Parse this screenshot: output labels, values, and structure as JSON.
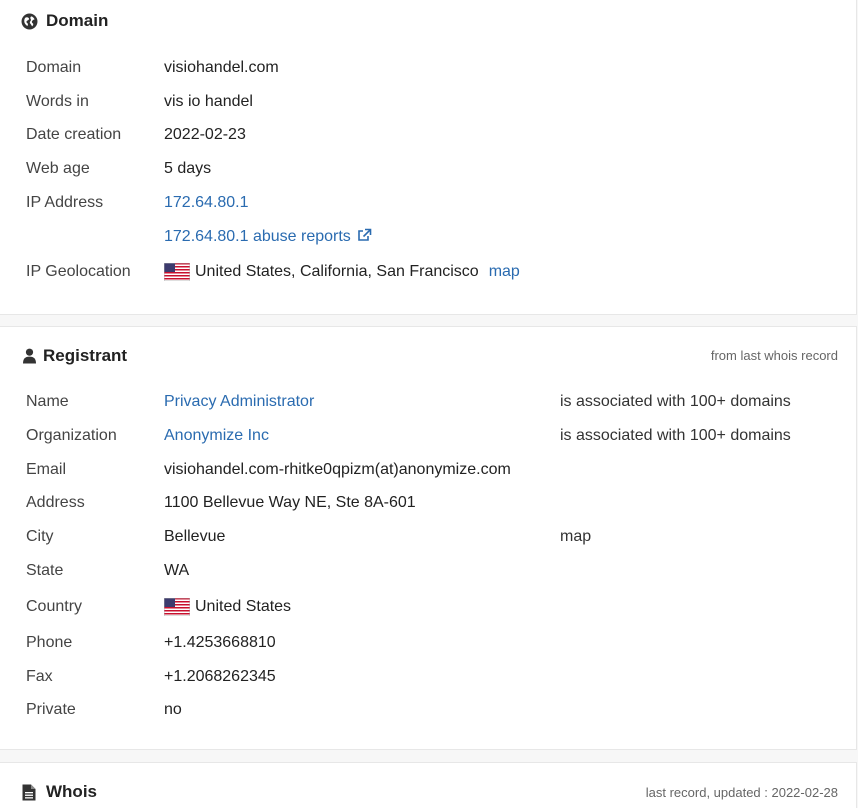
{
  "domain_panel": {
    "title": "Domain",
    "rows": [
      {
        "label": "Domain",
        "value": "visiohandel.com"
      },
      {
        "label": "Words in",
        "value": "vis io handel"
      },
      {
        "label": "Date creation",
        "value": "2022-02-23"
      },
      {
        "label": "Web age",
        "value": "5 days"
      },
      {
        "label": "IP Address",
        "value": "172.64.80.1"
      },
      {
        "label": "",
        "value": "172.64.80.1 abuse reports"
      },
      {
        "label": "IP Geolocation",
        "value": "United States, California, San Francisco",
        "map": "map"
      }
    ]
  },
  "registrant_panel": {
    "title": "Registrant",
    "note": "from last whois record",
    "rows": [
      {
        "label": "Name",
        "value": "Privacy Administrator",
        "extra": "is associated with 100+ domains"
      },
      {
        "label": "Organization",
        "value": "Anonymize Inc",
        "extra": "is associated with 100+ domains"
      },
      {
        "label": "Email",
        "value": "visiohandel.com-rhitke0qpizm(at)anonymize.com"
      },
      {
        "label": "Address",
        "value": "1100 Bellevue Way NE, Ste 8A-601"
      },
      {
        "label": "City",
        "value": "Bellevue",
        "extra": "map"
      },
      {
        "label": "State",
        "value": "WA"
      },
      {
        "label": "Country",
        "value": "United States"
      },
      {
        "label": "Phone",
        "value": "+1.4253668810"
      },
      {
        "label": "Fax",
        "value": "+1.2068262345"
      },
      {
        "label": "Private",
        "value": "no"
      }
    ]
  },
  "whois_panel": {
    "title": "Whois",
    "note": "last record, updated : 2022-02-28"
  },
  "icons": {
    "domain": "globe-icon",
    "registrant": "user-icon",
    "whois": "document-icon",
    "abuse": "external-link-icon",
    "flag": "us-flag-icon"
  },
  "colors": {
    "link": "#2a6bb0",
    "text": "#333333",
    "border": "#e7e7e7"
  }
}
